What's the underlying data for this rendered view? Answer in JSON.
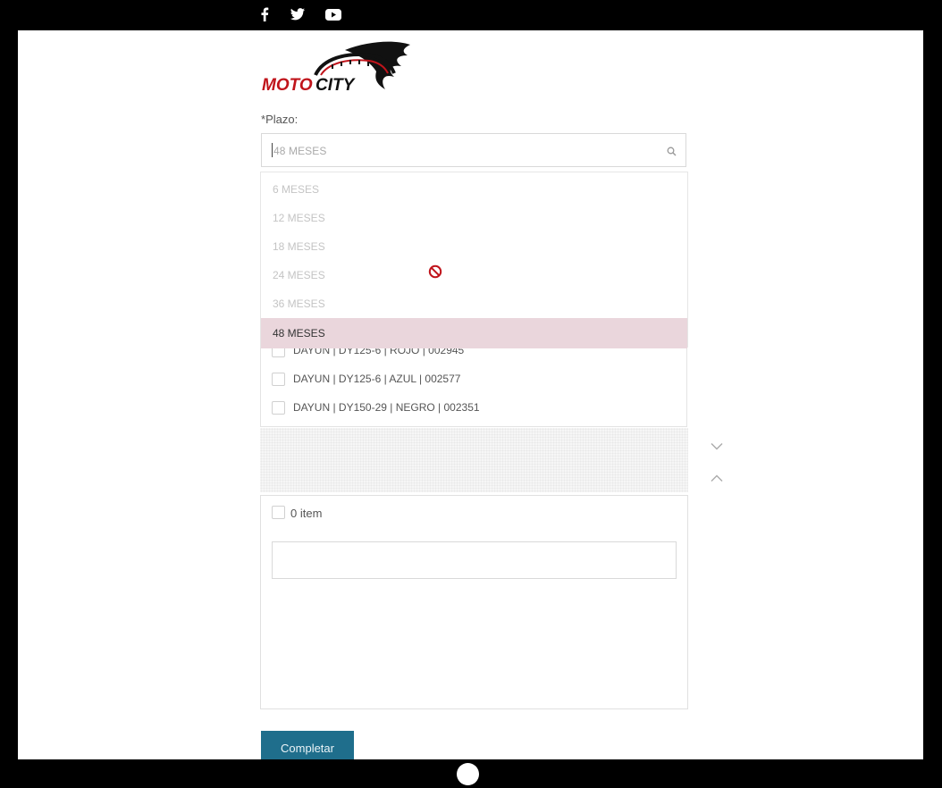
{
  "social": {
    "facebook": "facebook-icon",
    "twitter": "twitter-icon",
    "youtube": "youtube-icon"
  },
  "logo": {
    "text_moto": "MOTO",
    "text_city": "CITY"
  },
  "form": {
    "required_mark": "*",
    "plazo_label": "Plazo:",
    "plazo_value": "48 MESES",
    "options": [
      "6 MESES",
      "12 MESES",
      "18 MESES",
      "24 MESES",
      "36 MESES",
      "48 MESES"
    ],
    "selected_option": "48 MESES"
  },
  "transfer": {
    "source_items": [
      "DAYUN | DY125-6 | ROJO | 002945",
      "DAYUN | DY125-6 | AZUL | 002577",
      "DAYUN | DY150-29 | NEGRO | 002351"
    ],
    "target_count": "0 item"
  },
  "submit_label": "Completar",
  "colors": {
    "selected_bg": "#ead6dc",
    "button_bg": "#1f6e8c",
    "block_icon": "#c0141b"
  }
}
